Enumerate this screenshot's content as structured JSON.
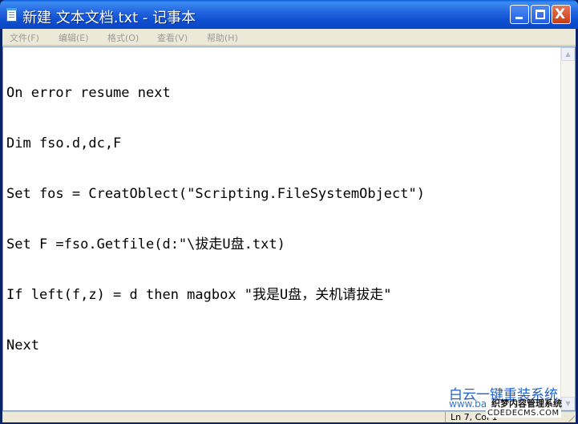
{
  "window": {
    "title": "新建 文本文档.txt - 记事本",
    "controls": {
      "minimize": "minimize",
      "maximize": "maximize",
      "close": "X"
    }
  },
  "menubar": {
    "items": [
      "文件(F)",
      "编辑(E)",
      "格式(O)",
      "查看(V)",
      "帮助(H)"
    ]
  },
  "editor": {
    "lines": [
      "On error resume next",
      "Dim fso.d,dc,F",
      "Set fos = CreatOblect(\"Scripting.FileSystemObject\")",
      "Set F =fso.Getfile(d:\"\\拔走U盘.txt)",
      "If left(f,z) = d then magbox \"我是U盘，关机请拔走\"",
      "Next"
    ]
  },
  "statusbar": {
    "position": "Ln 7, Col 1"
  },
  "watermarks": {
    "brand": "白云一键重装系统",
    "url": "www.ba",
    "cms_name": "织梦内容管理系统",
    "cms_url": "CDEDECMS.COM"
  },
  "colors": {
    "title_bar": "#0a5bd8",
    "close_button": "#c83b15",
    "frame": "#ece9d8",
    "watermark_brand": "#1d5fd0"
  }
}
